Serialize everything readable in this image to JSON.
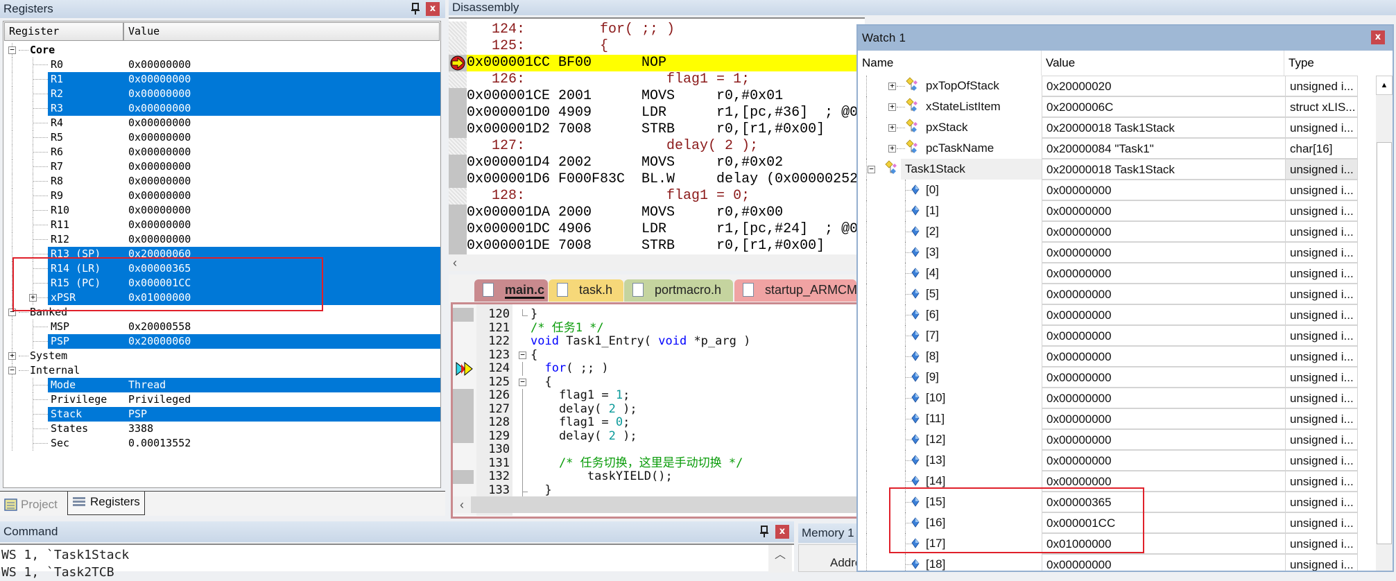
{
  "registers": {
    "title": "Registers",
    "col_register": "Register",
    "col_value": "Value",
    "rows": [
      {
        "name": "Core",
        "value": "",
        "level": 0,
        "expander": "minus",
        "bold": true
      },
      {
        "name": "R0",
        "value": "0x00000000",
        "level": 1
      },
      {
        "name": "R1",
        "value": "0x00000000",
        "level": 1,
        "selected": true
      },
      {
        "name": "R2",
        "value": "0x00000000",
        "level": 1,
        "selected": true
      },
      {
        "name": "R3",
        "value": "0x00000000",
        "level": 1,
        "selected": true
      },
      {
        "name": "R4",
        "value": "0x00000000",
        "level": 1
      },
      {
        "name": "R5",
        "value": "0x00000000",
        "level": 1
      },
      {
        "name": "R6",
        "value": "0x00000000",
        "level": 1
      },
      {
        "name": "R7",
        "value": "0x00000000",
        "level": 1
      },
      {
        "name": "R8",
        "value": "0x00000000",
        "level": 1
      },
      {
        "name": "R9",
        "value": "0x00000000",
        "level": 1
      },
      {
        "name": "R10",
        "value": "0x00000000",
        "level": 1
      },
      {
        "name": "R11",
        "value": "0x00000000",
        "level": 1
      },
      {
        "name": "R12",
        "value": "0x00000000",
        "level": 1
      },
      {
        "name": "R13 (SP)",
        "value": "0x20000060",
        "level": 1,
        "selected": true
      },
      {
        "name": "R14 (LR)",
        "value": "0x00000365",
        "level": 1,
        "selected": true
      },
      {
        "name": "R15 (PC)",
        "value": "0x000001CC",
        "level": 1,
        "selected": true
      },
      {
        "name": "xPSR",
        "value": "0x01000000",
        "level": 1,
        "selected": true,
        "expander": "plus"
      },
      {
        "name": "Banked",
        "value": "",
        "level": 0,
        "expander": "minus"
      },
      {
        "name": "MSP",
        "value": "0x20000558",
        "level": 1
      },
      {
        "name": "PSP",
        "value": "0x20000060",
        "level": 1,
        "selected": true
      },
      {
        "name": "System",
        "value": "",
        "level": 0,
        "expander": "plus"
      },
      {
        "name": "Internal",
        "value": "",
        "level": 0,
        "expander": "minus"
      },
      {
        "name": "Mode",
        "value": "Thread",
        "level": 1,
        "selected": true
      },
      {
        "name": "Privilege",
        "value": "Privileged",
        "level": 1
      },
      {
        "name": "Stack",
        "value": "PSP",
        "level": 1,
        "selected": true
      },
      {
        "name": "States",
        "value": "3388",
        "level": 1
      },
      {
        "name": "Sec",
        "value": "0.00013552",
        "level": 1
      }
    ],
    "tabs": [
      {
        "label": "Project",
        "active": false
      },
      {
        "label": "Registers",
        "active": true
      }
    ]
  },
  "disassembly": {
    "title": "Disassembly",
    "rows": [
      {
        "kind": "src",
        "text": "   124:         for( ;; )"
      },
      {
        "kind": "src",
        "text": "   125:         {"
      },
      {
        "kind": "asm",
        "addr": "0x000001CC",
        "opcode": "BF00",
        "mnemonic": "NOP",
        "operands": "",
        "current": true
      },
      {
        "kind": "src",
        "text": "   126:                 flag1 = 1;"
      },
      {
        "kind": "asm",
        "addr": "0x000001CE",
        "opcode": "2001",
        "mnemonic": "MOVS",
        "operands": "r0,#0x01"
      },
      {
        "kind": "asm",
        "addr": "0x000001D0",
        "opcode": "4909",
        "mnemonic": "LDR",
        "operands": "r1,[pc,#36]  ; @0"
      },
      {
        "kind": "asm",
        "addr": "0x000001D2",
        "opcode": "7008",
        "mnemonic": "STRB",
        "operands": "r0,[r1,#0x00]"
      },
      {
        "kind": "src",
        "text": "   127:                 delay( 2 );"
      },
      {
        "kind": "asm",
        "addr": "0x000001D4",
        "opcode": "2002",
        "mnemonic": "MOVS",
        "operands": "r0,#0x02"
      },
      {
        "kind": "asm",
        "addr": "0x000001D6",
        "opcode": "F000F83C",
        "mnemonic": "BL.W",
        "operands": "delay (0x00000252"
      },
      {
        "kind": "src",
        "text": "   128:                 flag1 = 0;"
      },
      {
        "kind": "asm",
        "addr": "0x000001DA",
        "opcode": "2000",
        "mnemonic": "MOVS",
        "operands": "r0,#0x00"
      },
      {
        "kind": "asm",
        "addr": "0x000001DC",
        "opcode": "4906",
        "mnemonic": "LDR",
        "operands": "r1,[pc,#24]  ; @0"
      },
      {
        "kind": "asm",
        "addr": "0x000001DE",
        "opcode": "7008",
        "mnemonic": "STRB",
        "operands": "r0,[r1,#0x00]"
      }
    ]
  },
  "editor": {
    "tabs": [
      {
        "label": "main.c",
        "color": "#c98a8e",
        "active": true
      },
      {
        "label": "task.h",
        "color": "#f6d879"
      },
      {
        "label": "portmacro.h",
        "color": "#c5d49f"
      },
      {
        "label": "startup_ARMCM",
        "color": "#f0a3a3"
      }
    ],
    "lines": [
      {
        "no": "120",
        "fold": "end",
        "seg": [
          {
            "t": "}",
            "c": "pl"
          }
        ]
      },
      {
        "no": "121",
        "seg": [
          {
            "t": "/* 任务1 */",
            "c": "cm"
          }
        ]
      },
      {
        "no": "122",
        "seg": [
          {
            "t": "void",
            "c": "kw"
          },
          {
            "t": " Task1_Entry( ",
            "c": "pl"
          },
          {
            "t": "void",
            "c": "kw"
          },
          {
            "t": " *p_arg )",
            "c": "pl"
          }
        ]
      },
      {
        "no": "123",
        "fold": "box",
        "seg": [
          {
            "t": "{",
            "c": "pl"
          }
        ]
      },
      {
        "no": "124",
        "marker": true,
        "seg": [
          {
            "t": "  ",
            "c": "pl"
          },
          {
            "t": "for",
            "c": "kw"
          },
          {
            "t": "( ;; )",
            "c": "pl"
          }
        ]
      },
      {
        "no": "125",
        "fold": "box",
        "seg": [
          {
            "t": "  {",
            "c": "pl"
          }
        ]
      },
      {
        "no": "126",
        "seg": [
          {
            "t": "    flag1 = ",
            "c": "pl"
          },
          {
            "t": "1",
            "c": "num"
          },
          {
            "t": ";",
            "c": "pl"
          }
        ]
      },
      {
        "no": "127",
        "seg": [
          {
            "t": "    delay( ",
            "c": "pl"
          },
          {
            "t": "2",
            "c": "num"
          },
          {
            "t": " );",
            "c": "pl"
          }
        ]
      },
      {
        "no": "128",
        "seg": [
          {
            "t": "    flag1 = ",
            "c": "pl"
          },
          {
            "t": "0",
            "c": "num"
          },
          {
            "t": ";",
            "c": "pl"
          }
        ]
      },
      {
        "no": "129",
        "seg": [
          {
            "t": "    delay( ",
            "c": "pl"
          },
          {
            "t": "2",
            "c": "num"
          },
          {
            "t": " );",
            "c": "pl"
          }
        ]
      },
      {
        "no": "130",
        "seg": []
      },
      {
        "no": "131",
        "seg": [
          {
            "t": "    /* 任务切换，这里是手动切换 */",
            "c": "cm"
          }
        ]
      },
      {
        "no": "132",
        "seg": [
          {
            "t": "        taskYIELD();",
            "c": "pl"
          }
        ]
      },
      {
        "no": "133",
        "fold": "end",
        "seg": [
          {
            "t": "  }",
            "c": "pl"
          }
        ]
      }
    ]
  },
  "command": {
    "title": "Command",
    "lines": [
      "WS 1, `Task1Stack",
      "WS 1, `Task2TCB"
    ]
  },
  "memory": {
    "title": "Memory 1",
    "address_label": "Address:"
  },
  "watch": {
    "title": "Watch 1",
    "col_name": "Name",
    "col_value": "Value",
    "col_type": "Type",
    "rows": [
      {
        "name": "pxTopOfStack",
        "value": "0x20000020",
        "type": "unsigned i...",
        "kind": "member",
        "expander": "plus"
      },
      {
        "name": "xStateListItem",
        "value": "0x2000006C",
        "type": "struct xLIS...",
        "kind": "member",
        "expander": "plus"
      },
      {
        "name": "pxStack",
        "value": "0x20000018 Task1Stack",
        "type": "unsigned i...",
        "kind": "member",
        "expander": "plus"
      },
      {
        "name": "pcTaskName",
        "value": "0x20000084 \"Task1\"",
        "type": "char[16]",
        "kind": "member",
        "expander": "plus"
      },
      {
        "name": "Task1Stack",
        "value": "0x20000018 Task1Stack",
        "type": "unsigned i...",
        "kind": "root",
        "expander": "minus",
        "highlight": true
      },
      {
        "name": "[0]",
        "value": "0x00000000",
        "type": "unsigned i...",
        "kind": "element"
      },
      {
        "name": "[1]",
        "value": "0x00000000",
        "type": "unsigned i...",
        "kind": "element"
      },
      {
        "name": "[2]",
        "value": "0x00000000",
        "type": "unsigned i...",
        "kind": "element"
      },
      {
        "name": "[3]",
        "value": "0x00000000",
        "type": "unsigned i...",
        "kind": "element"
      },
      {
        "name": "[4]",
        "value": "0x00000000",
        "type": "unsigned i...",
        "kind": "element"
      },
      {
        "name": "[5]",
        "value": "0x00000000",
        "type": "unsigned i...",
        "kind": "element"
      },
      {
        "name": "[6]",
        "value": "0x00000000",
        "type": "unsigned i...",
        "kind": "element"
      },
      {
        "name": "[7]",
        "value": "0x00000000",
        "type": "unsigned i...",
        "kind": "element"
      },
      {
        "name": "[8]",
        "value": "0x00000000",
        "type": "unsigned i...",
        "kind": "element"
      },
      {
        "name": "[9]",
        "value": "0x00000000",
        "type": "unsigned i...",
        "kind": "element"
      },
      {
        "name": "[10]",
        "value": "0x00000000",
        "type": "unsigned i...",
        "kind": "element"
      },
      {
        "name": "[11]",
        "value": "0x00000000",
        "type": "unsigned i...",
        "kind": "element"
      },
      {
        "name": "[12]",
        "value": "0x00000000",
        "type": "unsigned i...",
        "kind": "element"
      },
      {
        "name": "[13]",
        "value": "0x00000000",
        "type": "unsigned i...",
        "kind": "element"
      },
      {
        "name": "[14]",
        "value": "0x00000000",
        "type": "unsigned i...",
        "kind": "element"
      },
      {
        "name": "[15]",
        "value": "0x00000365",
        "type": "unsigned i...",
        "kind": "element"
      },
      {
        "name": "[16]",
        "value": "0x000001CC",
        "type": "unsigned i...",
        "kind": "element"
      },
      {
        "name": "[17]",
        "value": "0x01000000",
        "type": "unsigned i...",
        "kind": "element"
      },
      {
        "name": "[18]",
        "value": "0x00000000",
        "type": "unsigned i...",
        "kind": "element"
      }
    ]
  },
  "colors": {
    "selection": "#0078d7",
    "current_line": "#ffff00",
    "annotation_box": "#e0202a",
    "close": "#c8474c"
  }
}
